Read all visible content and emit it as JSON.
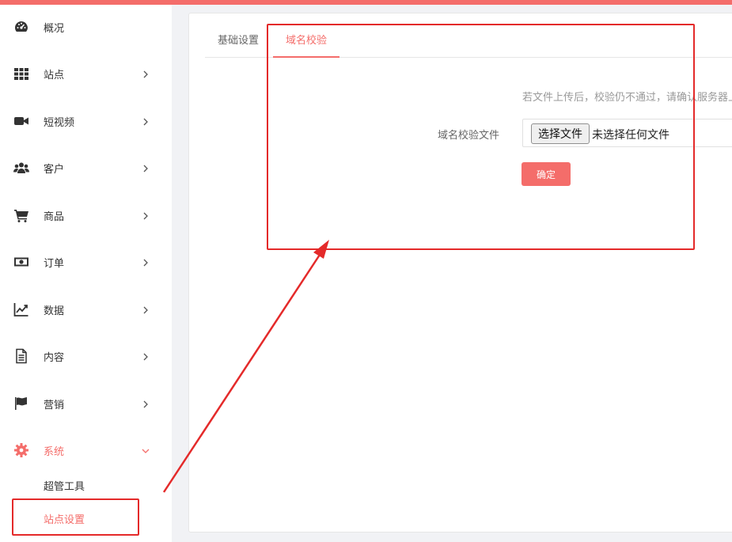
{
  "colors": {
    "accent": "#f46d6a",
    "annotation": "#e42a2a",
    "sidebar_bg": "#ffffff",
    "page_bg": "#f1f2f5"
  },
  "sidebar": {
    "items": [
      {
        "label": "概况",
        "icon": "dashboard-icon",
        "has_chevron": false
      },
      {
        "label": "站点",
        "icon": "grid-icon",
        "has_chevron": true
      },
      {
        "label": "短视频",
        "icon": "video-camera-icon",
        "has_chevron": true
      },
      {
        "label": "客户",
        "icon": "users-icon",
        "has_chevron": true
      },
      {
        "label": "商品",
        "icon": "cart-icon",
        "has_chevron": true
      },
      {
        "label": "订单",
        "icon": "money-icon",
        "has_chevron": true
      },
      {
        "label": "数据",
        "icon": "line-chart-icon",
        "has_chevron": true
      },
      {
        "label": "内容",
        "icon": "document-icon",
        "has_chevron": true
      },
      {
        "label": "营销",
        "icon": "flag-icon",
        "has_chevron": true
      },
      {
        "label": "系统",
        "icon": "gear-icon",
        "has_chevron": true,
        "active": true,
        "expanded": true
      }
    ],
    "subitems": [
      {
        "label": "超管工具"
      },
      {
        "label": "站点设置",
        "active": true
      }
    ]
  },
  "main": {
    "tabs": [
      {
        "label": "基础设置"
      },
      {
        "label": "域名校验",
        "active": true
      }
    ],
    "hint": "若文件上传后，校验仍不通过，请确认服务器上",
    "field_label": "域名校验文件",
    "file_button": "选择文件",
    "file_status": "未选择任何文件",
    "confirm": "确定"
  }
}
